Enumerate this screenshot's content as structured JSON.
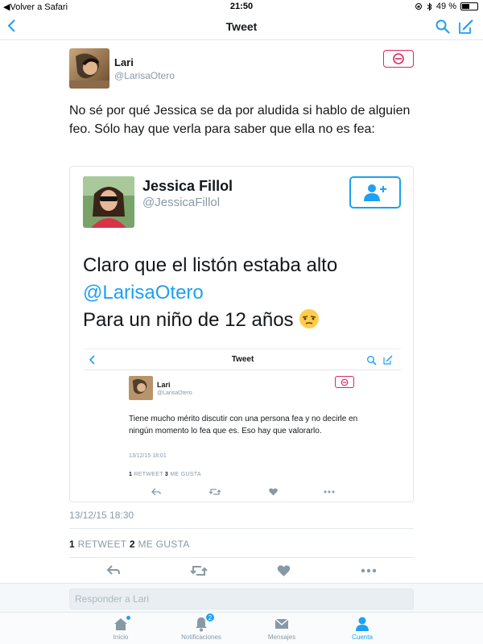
{
  "status_bar": {
    "back_label": "Volver a Safari",
    "time": "21:50",
    "battery": "49 %",
    "battery_level": 0.49
  },
  "nav": {
    "title": "Tweet"
  },
  "tweet": {
    "author_name": "Lari",
    "author_handle": "@LarisaOtero",
    "text": "No sé por qué Jessica se da por aludida si hablo de alguien feo. Sólo hay que verla para saber que ella no es fea:",
    "date": "13/12/15 18:30",
    "retweets_count": "1",
    "retweets_label": "RETWEET",
    "likes_count": "2",
    "likes_label": "ME GUSTA"
  },
  "quoted": {
    "author_name": "Jessica Fillol",
    "author_handle": "@JessicaFillol",
    "text_line1": "Claro que el listón estaba alto",
    "mention": "@LarisaOtero",
    "text_line3": "Para un niño de 12 años",
    "embedded": {
      "nav_title": "Tweet",
      "author_name": "Lari",
      "author_handle": "@LarisaOtero",
      "text": "Tiene mucho mérito discutir con una persona fea y no decirle en ningún momento lo fea que es. Eso hay que valorarlo.",
      "date": "13/12/15 18:01",
      "retweets_count": "1",
      "retweets_label": "RETWEET",
      "likes_count": "3",
      "likes_label": "ME GUSTA"
    }
  },
  "reply": {
    "placeholder": "Responder a Lari"
  },
  "tabbar": {
    "items": [
      {
        "label": "Inicio"
      },
      {
        "label": "Notificaciones",
        "badge": "2"
      },
      {
        "label": "Mensajes"
      },
      {
        "label": "Cuenta"
      }
    ]
  },
  "colors": {
    "accent": "#1da1f2",
    "block": "#e0245e",
    "muted": "#8899a6"
  }
}
